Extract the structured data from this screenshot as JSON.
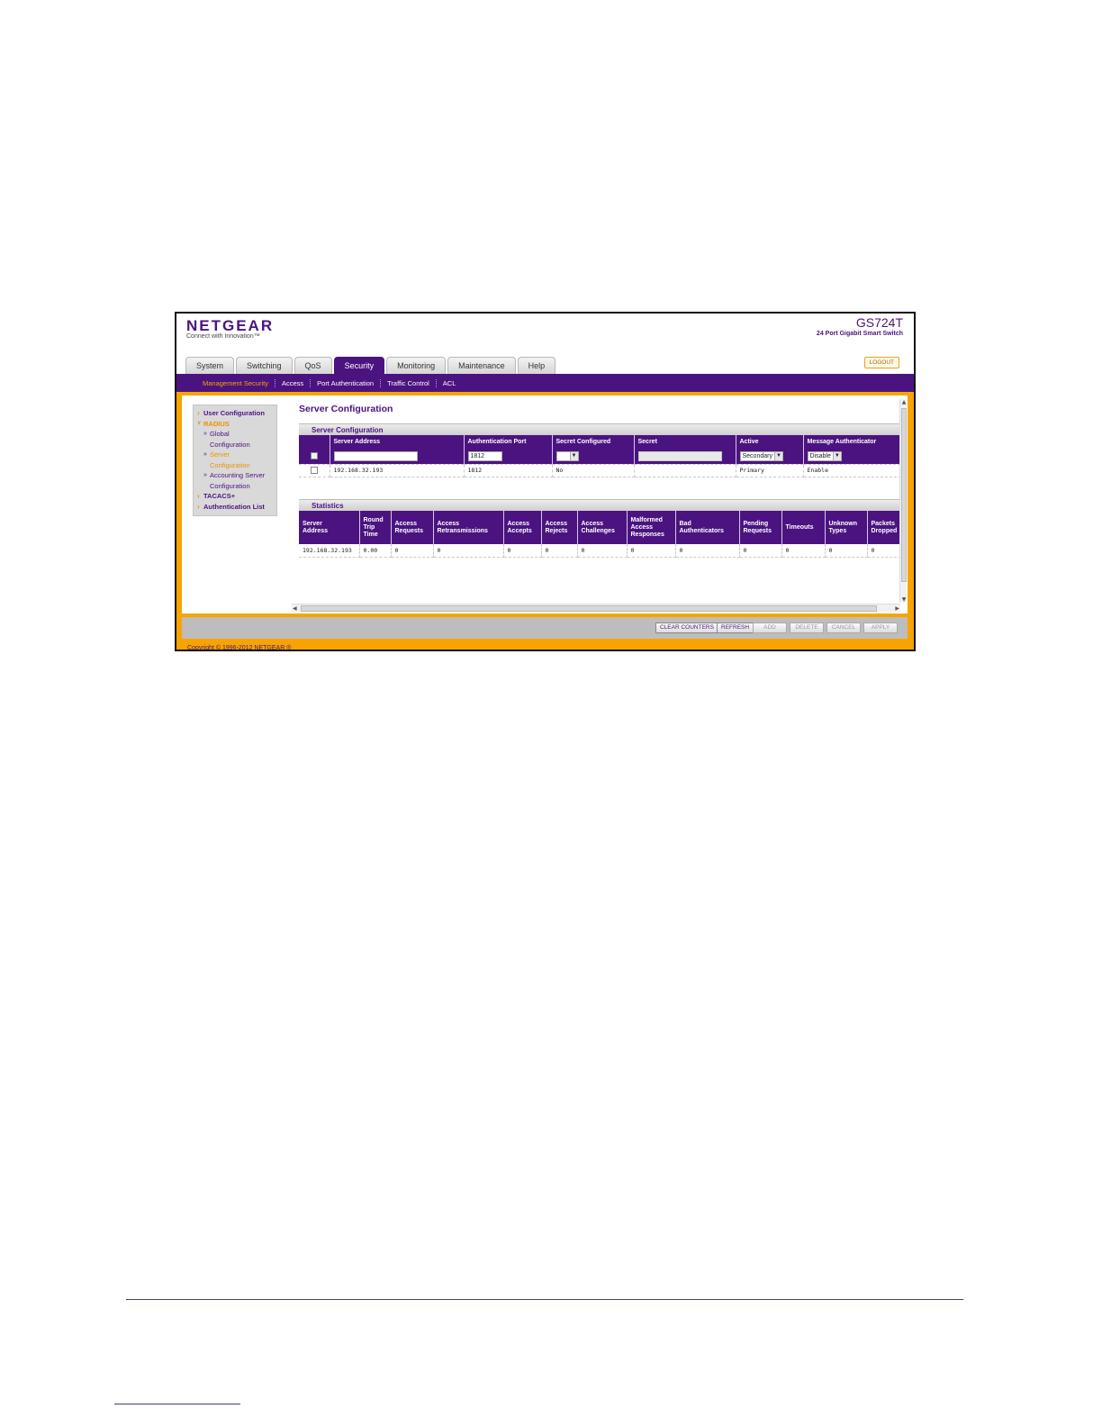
{
  "header": {
    "logo": "NETGEAR",
    "tagline": "Connect with Innovation™",
    "model": "GS724T",
    "model_desc": "24 Port Gigabit Smart Switch",
    "logout": "LOGOUT"
  },
  "tabs": [
    "System",
    "Switching",
    "QoS",
    "Security",
    "Monitoring",
    "Maintenance",
    "Help"
  ],
  "active_tab": "Security",
  "subnav": [
    "Management Security",
    "Access",
    "Port Authentication",
    "Traffic Control",
    "ACL"
  ],
  "sidebar": {
    "user_configuration": "User Configuration",
    "radius": "RADIUS",
    "global_1": "Global",
    "global_2": "Configuration",
    "server_1": "Server",
    "server_2": "Configuration",
    "accounting_1": "Accounting Server",
    "accounting_2": "Configuration",
    "tacacs": "TACACS+",
    "auth_list": "Authentication List"
  },
  "page_title": "Server Configuration",
  "server_config": {
    "section_title": "Server Configuration",
    "columns": [
      "Server Address",
      "Authentication Port",
      "Secret Configured",
      "Secret",
      "Active",
      "Message Authenticator"
    ],
    "edit_row": {
      "auth_port": "1812",
      "secret_configured": "",
      "active": "Secondary",
      "message_authenticator": "Disable"
    },
    "rows": [
      {
        "server_address": "192.168.32.193",
        "auth_port": "1812",
        "secret_configured": "No",
        "secret": "",
        "active": "Primary",
        "message_authenticator": "Enable"
      }
    ]
  },
  "statistics": {
    "section_title": "Statistics",
    "columns": [
      [
        "Server",
        "Address"
      ],
      [
        "Round",
        "Trip",
        "Time"
      ],
      [
        "Access",
        "Requests"
      ],
      [
        "Access",
        "Retransmissions"
      ],
      [
        "Access",
        "Accepts"
      ],
      [
        "Access",
        "Rejects"
      ],
      [
        "Access",
        "Challenges"
      ],
      [
        "Malformed",
        "Access",
        "Responses"
      ],
      [
        "Bad",
        "Authenticators"
      ],
      [
        "Pending",
        "Requests"
      ],
      [
        "Timeouts"
      ],
      [
        "Unknown",
        "Types"
      ],
      [
        "Packets",
        "Dropped"
      ]
    ],
    "row": [
      "192.168.32.193",
      "0.00",
      "0",
      "0",
      "0",
      "0",
      "0",
      "0",
      "0",
      "0",
      "0",
      "0",
      "0"
    ]
  },
  "buttons": {
    "clear_counters": "CLEAR COUNTERS",
    "refresh": "REFRESH",
    "add": "ADD",
    "delete": "DELETE",
    "cancel": "CANCEL",
    "apply": "APPLY"
  },
  "copyright": "Copyright © 1996-2012 NETGEAR ®",
  "colors": {
    "brand_purple": "#4b1380",
    "accent_orange": "#f7a400"
  }
}
